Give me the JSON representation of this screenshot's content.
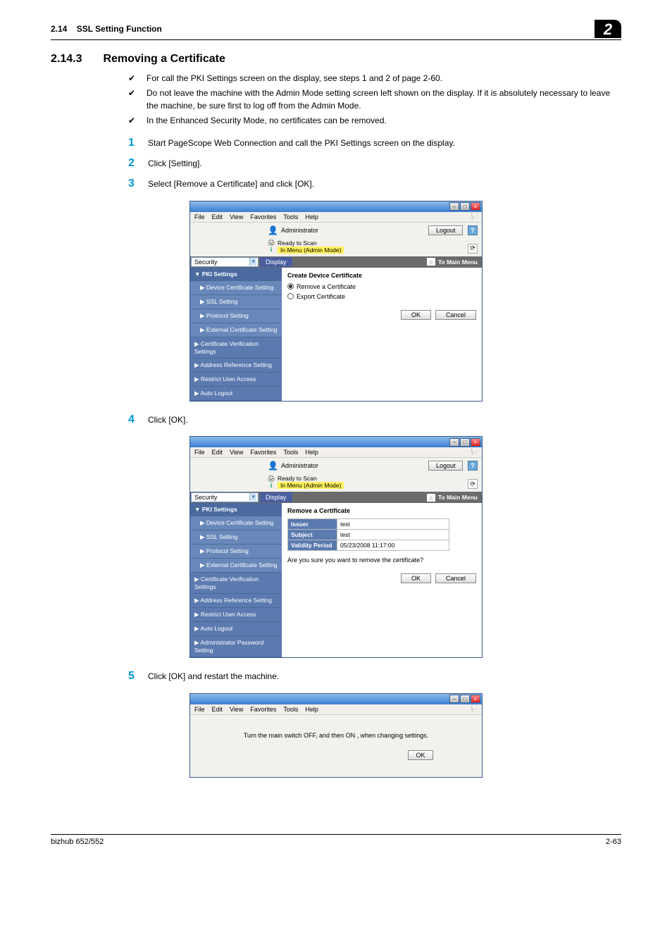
{
  "header": {
    "section": "2.14",
    "title": "SSL Setting Function",
    "chapter": "2"
  },
  "section_heading": {
    "num": "2.14.3",
    "text": "Removing a Certificate"
  },
  "bullets": [
    "For call the PKI Settings screen on the display, see steps 1 and 2 of page 2-60.",
    "Do not leave the machine with the Admin Mode setting screen left shown on the display. If it is absolutely necessary to leave the machine, be sure first to log off from the Admin Mode.",
    "In the Enhanced Security Mode, no certificates can be removed."
  ],
  "steps": [
    "Start PageScope Web Connection and call the PKI Settings screen on the display.",
    "Click [Setting].",
    "Select [Remove a Certificate] and click [OK].",
    "Click [OK].",
    "Click [OK] and restart the machine."
  ],
  "menubar": {
    "file": "File",
    "edit": "Edit",
    "view": "View",
    "fav": "Favorites",
    "tools": "Tools",
    "help": "Help"
  },
  "admin": {
    "label": "Administrator",
    "logout": "Logout"
  },
  "status": {
    "ready": "Ready to Scan",
    "inmenu": "In Menu (Admin Mode)"
  },
  "toolbar": {
    "dropdown": "Security",
    "display": "Display",
    "tomain": "To Main Menu"
  },
  "sidebar_common": {
    "pki": "PKI Settings",
    "dcs": "Device Certificate Setting",
    "ssl": "SSL Setting",
    "proto": "Protocol Setting",
    "ext": "External Certificate Setting",
    "certver": "Certificate Verification Settings",
    "addr": "Address Reference Setting",
    "restrict": "Restrict User Access",
    "auto": "Auto Logout",
    "adminpw": "Administrator Password Setting"
  },
  "screenshot1": {
    "title": "Create Device Certificate",
    "r1": "Remove a Certificate",
    "r2": "Export Certificate",
    "ok": "OK",
    "cancel": "Cancel"
  },
  "screenshot2": {
    "title": "Remove a Certificate",
    "rows": {
      "issuer_h": "Issuer",
      "issuer_v": "test",
      "subject_h": "Subject",
      "subject_v": "test",
      "valid_h": "Validity Period",
      "valid_v": "05/23/2008 11:17:00"
    },
    "confirm": "Are you sure you want to remove the certificate?",
    "ok": "OK",
    "cancel": "Cancel"
  },
  "screenshot3": {
    "msg": "Turn the main switch OFF, and then ON , when changing settings.",
    "ok": "OK"
  },
  "footer": {
    "product": "bizhub 652/552",
    "page": "2-63"
  }
}
